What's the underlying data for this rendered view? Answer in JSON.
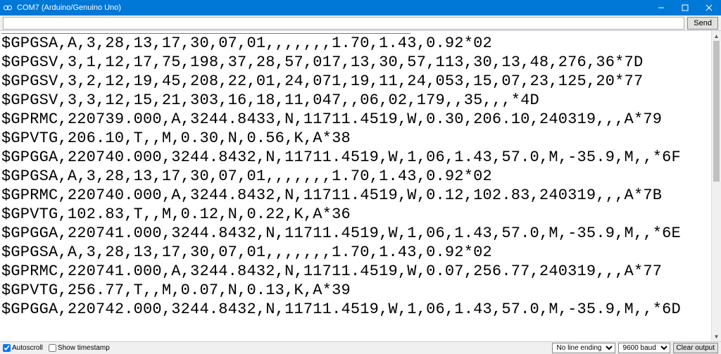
{
  "titlebar": {
    "title": "COM7 (Arduino/Genuino Uno)"
  },
  "toolbar": {
    "send_label": "Send",
    "input_value": ""
  },
  "output": {
    "lines": [
      "$GPGSA,A,3,28,13,17,30,07,01,,,,,,,1.70,1.43,0.92*02",
      "$GPGSV,3,1,12,17,75,198,37,28,57,017,13,30,57,113,30,13,48,276,36*7D",
      "$GPGSV,3,2,12,19,45,208,22,01,24,071,19,11,24,053,15,07,23,125,20*77",
      "$GPGSV,3,3,12,15,21,303,16,18,11,047,,06,02,179,,35,,,*4D",
      "$GPRMC,220739.000,A,3244.8433,N,11711.4519,W,0.30,206.10,240319,,,A*79",
      "$GPVTG,206.10,T,,M,0.30,N,0.56,K,A*38",
      "$GPGGA,220740.000,3244.8432,N,11711.4519,W,1,06,1.43,57.0,M,-35.9,M,,*6F",
      "$GPGSA,A,3,28,13,17,30,07,01,,,,,,,1.70,1.43,0.92*02",
      "$GPRMC,220740.000,A,3244.8432,N,11711.4519,W,0.12,102.83,240319,,,A*7B",
      "$GPVTG,102.83,T,,M,0.12,N,0.22,K,A*36",
      "$GPGGA,220741.000,3244.8432,N,11711.4519,W,1,06,1.43,57.0,M,-35.9,M,,*6E",
      "$GPGSA,A,3,28,13,17,30,07,01,,,,,,,1.70,1.43,0.92*02",
      "$GPRMC,220741.000,A,3244.8432,N,11711.4519,W,0.07,256.77,240319,,,A*77",
      "$GPVTG,256.77,T,,M,0.07,N,0.13,K,A*39",
      "$GPGGA,220742.000,3244.8432,N,11711.4519,W,1,06,1.43,57.0,M,-35.9,M,,*6D"
    ]
  },
  "bottom": {
    "autoscroll_label": "Autoscroll",
    "autoscroll_checked": true,
    "timestamp_label": "Show timestamp",
    "timestamp_checked": false,
    "line_ending_selected": "No line ending",
    "baud_selected": "9600 baud",
    "clear_label": "Clear output"
  }
}
